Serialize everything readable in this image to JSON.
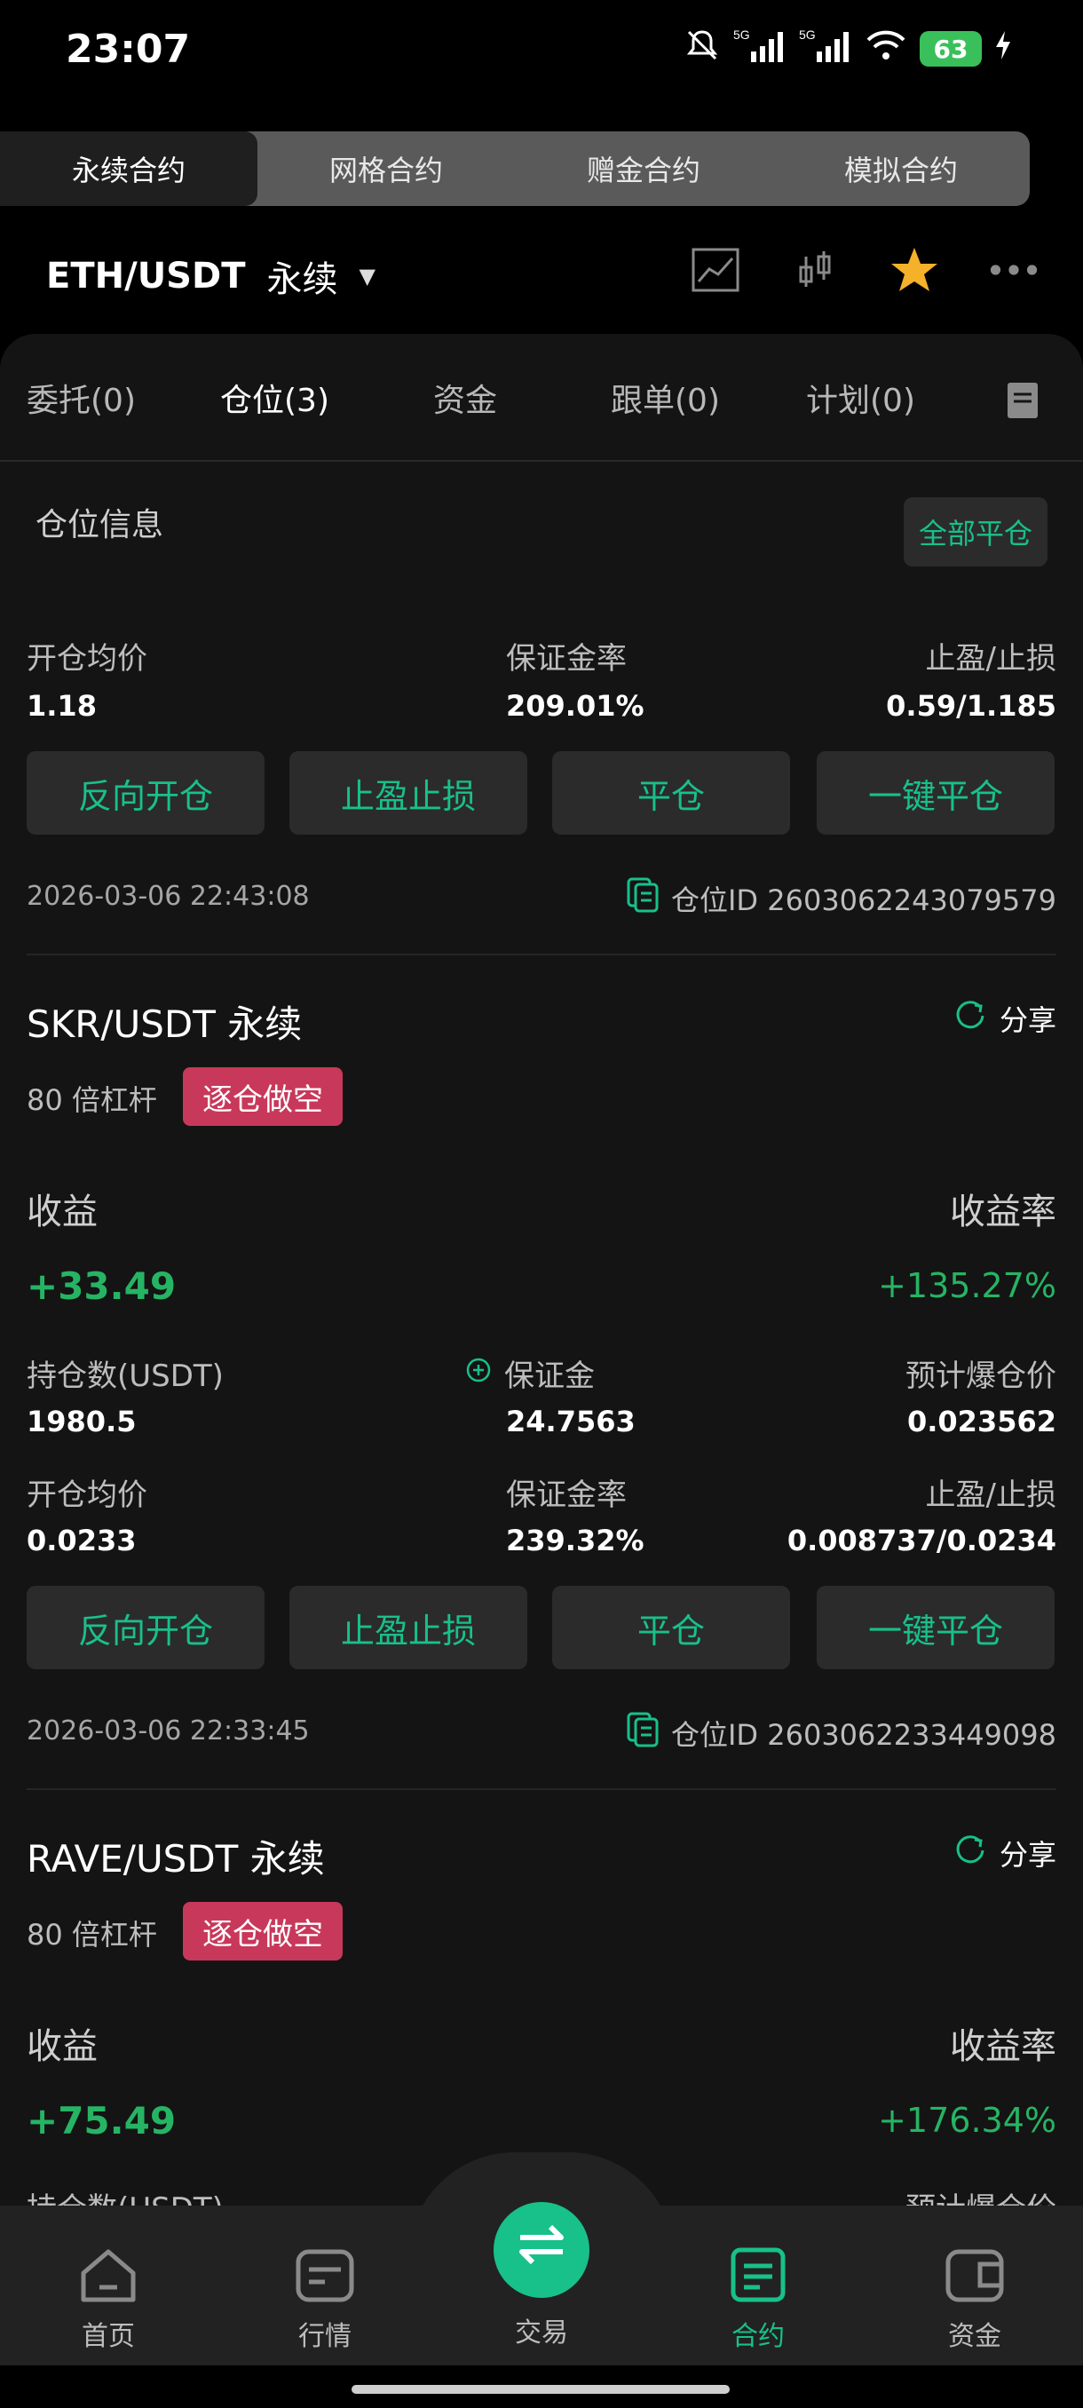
{
  "status": {
    "time": "23:07",
    "battery": "63",
    "net1": "5G",
    "net2": "5G"
  },
  "segtabs": [
    "永续合约",
    "网格合约",
    "赠金合约",
    "模拟合约"
  ],
  "pair": {
    "name": "ETH/USDT",
    "type": "永续",
    "caret": "▼"
  },
  "subtabs": [
    "委托(0)",
    "仓位(3)",
    "资金",
    "跟单(0)",
    "计划(0)"
  ],
  "position_info": {
    "title": "仓位信息",
    "close_all": "全部平仓",
    "open_avg_label": "开仓均价",
    "open_avg": "1.18",
    "margin_rate_label": "保证金率",
    "margin_rate": "209.01%",
    "tp_sl_label": "止盈/止损",
    "tp_sl": "0.59/1.185",
    "buttons": [
      "反向开仓",
      "止盈止损",
      "平仓",
      "一键平仓"
    ],
    "date": "2026-03-06 22:43:08",
    "pos_id": "仓位ID 2603062243079579"
  },
  "pos2": {
    "symbol": "SKR/USDT 永续",
    "share": "分享",
    "leverage": "80 倍杠杆",
    "tag": "逐仓做空",
    "pnl_label": "收益",
    "pnl": "+33.49",
    "pnl_rate_label": "收益率",
    "pnl_rate": "+135.27%",
    "qty_label": "持仓数(USDT)",
    "qty": "1980.5",
    "margin_label": "保证金",
    "margin": "24.7563",
    "liq_label": "预计爆仓价",
    "liq": "0.023562",
    "open_avg_label": "开仓均价",
    "open_avg": "0.0233",
    "margin_rate_label": "保证金率",
    "margin_rate": "239.32%",
    "tp_sl_label": "止盈/止损",
    "tp_sl": "0.008737/0.0234",
    "buttons": [
      "反向开仓",
      "止盈止损",
      "平仓",
      "一键平仓"
    ],
    "date": "2026-03-06 22:33:45",
    "pos_id": "仓位ID 2603062233449098"
  },
  "pos3": {
    "symbol": "RAVE/USDT 永续",
    "share": "分享",
    "leverage": "80 倍杠杆",
    "tag": "逐仓做空",
    "pnl_label": "收益",
    "pnl": "+75.49",
    "pnl_rate_label": "收益率",
    "pnl_rate": "+176.34%",
    "qty_label": "持仓数(USDT)",
    "liq_label": "预计爆仓价"
  },
  "nav": [
    "首页",
    "行情",
    "交易",
    "合约",
    "资金"
  ],
  "colors": {
    "accent": "#18c08a",
    "profit": "#26b464",
    "short_tag": "#c8385a",
    "star": "#f5b12a"
  }
}
